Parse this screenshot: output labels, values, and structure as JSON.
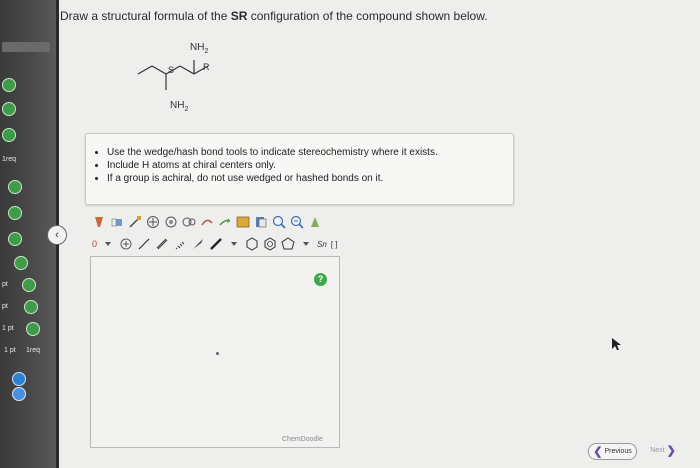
{
  "question": {
    "prefix": "Draw a structural formula of the ",
    "config": "SR",
    "suffix": " configuration of the compound shown below."
  },
  "molecule": {
    "top_group": "NH",
    "top_sub": "2",
    "bottom_group": "NH",
    "bottom_sub": "2",
    "stereo_left": "S",
    "stereo_right": "R"
  },
  "instructions": [
    "Use the wedge/hash bond tools to indicate stereochemistry where it exists.",
    "Include H atoms at chiral centers only.",
    "If a group is achiral, do not use wedged or hashed bonds on it."
  ],
  "sidebar": {
    "labels": [
      "1req",
      "pt",
      "pt",
      "1 pt",
      "1 pt",
      "1req"
    ]
  },
  "toolbar": {
    "charge_label": "0",
    "sn_label": "Sn",
    "bracket_label": "[ ]"
  },
  "canvas": {
    "help_label": "?",
    "brand": "ChemDoodle"
  },
  "nav": {
    "previous_label": "Previous",
    "next_label": "Next"
  },
  "colors": {
    "accent": "#3ea84a",
    "nav_arrow": "#6c4fa3"
  }
}
